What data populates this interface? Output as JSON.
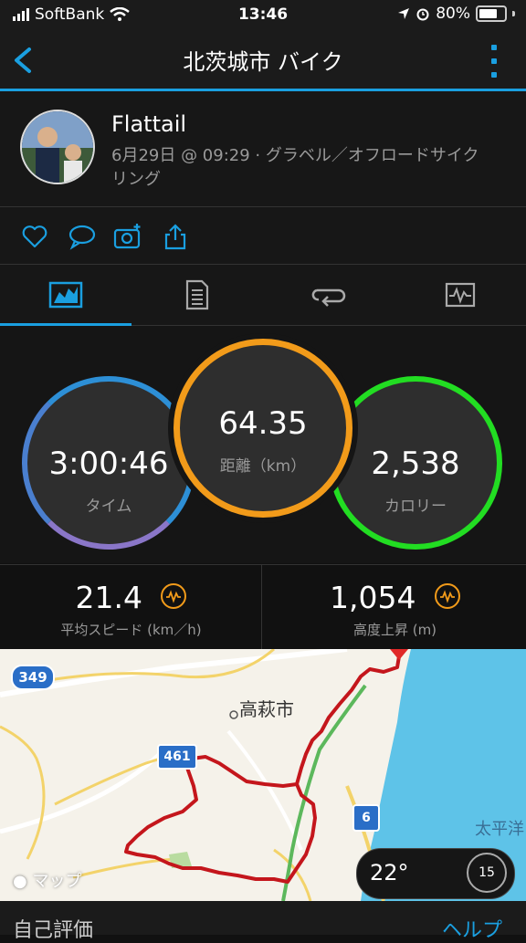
{
  "status_bar": {
    "carrier": "SoftBank",
    "time": "13:46",
    "battery": "80%"
  },
  "header": {
    "title": "北茨城市 バイク"
  },
  "profile": {
    "name": "Flattail",
    "date": "6月29日 @ 09:29",
    "activity_type": "グラベル／オフロードサイクリング"
  },
  "tabs": [
    {
      "name": "overview",
      "active": true
    },
    {
      "name": "details",
      "active": false
    },
    {
      "name": "laps",
      "active": false
    },
    {
      "name": "charts",
      "active": false
    }
  ],
  "stats": {
    "time": {
      "value": "3:00:46",
      "label": "タイム"
    },
    "distance": {
      "value": "64.35",
      "label": "距離（km）"
    },
    "calories": {
      "value": "2,538",
      "label": "カロリー"
    }
  },
  "substats": {
    "avg_speed": {
      "value": "21.4",
      "label": "平均スピード (km／h)"
    },
    "elevation_gain": {
      "value": "1,054",
      "label": "高度上昇 (m)"
    }
  },
  "map": {
    "city_label": "高萩市",
    "sea_label": "太平洋",
    "route_349": "349",
    "route_461": "461",
    "route_6": "6",
    "maps_label": "マップ",
    "temperature": "22°",
    "wind_speed": "15"
  },
  "bottom": {
    "self_eval": "自己評価",
    "help": "ヘルプ"
  },
  "colors": {
    "accent": "#1a9fe0",
    "time_ring": "#2d8fd6",
    "distance_ring": "#f29b1a",
    "calories_ring": "#22dd22",
    "route": "#c4161c",
    "sea": "#5ec3e8"
  }
}
